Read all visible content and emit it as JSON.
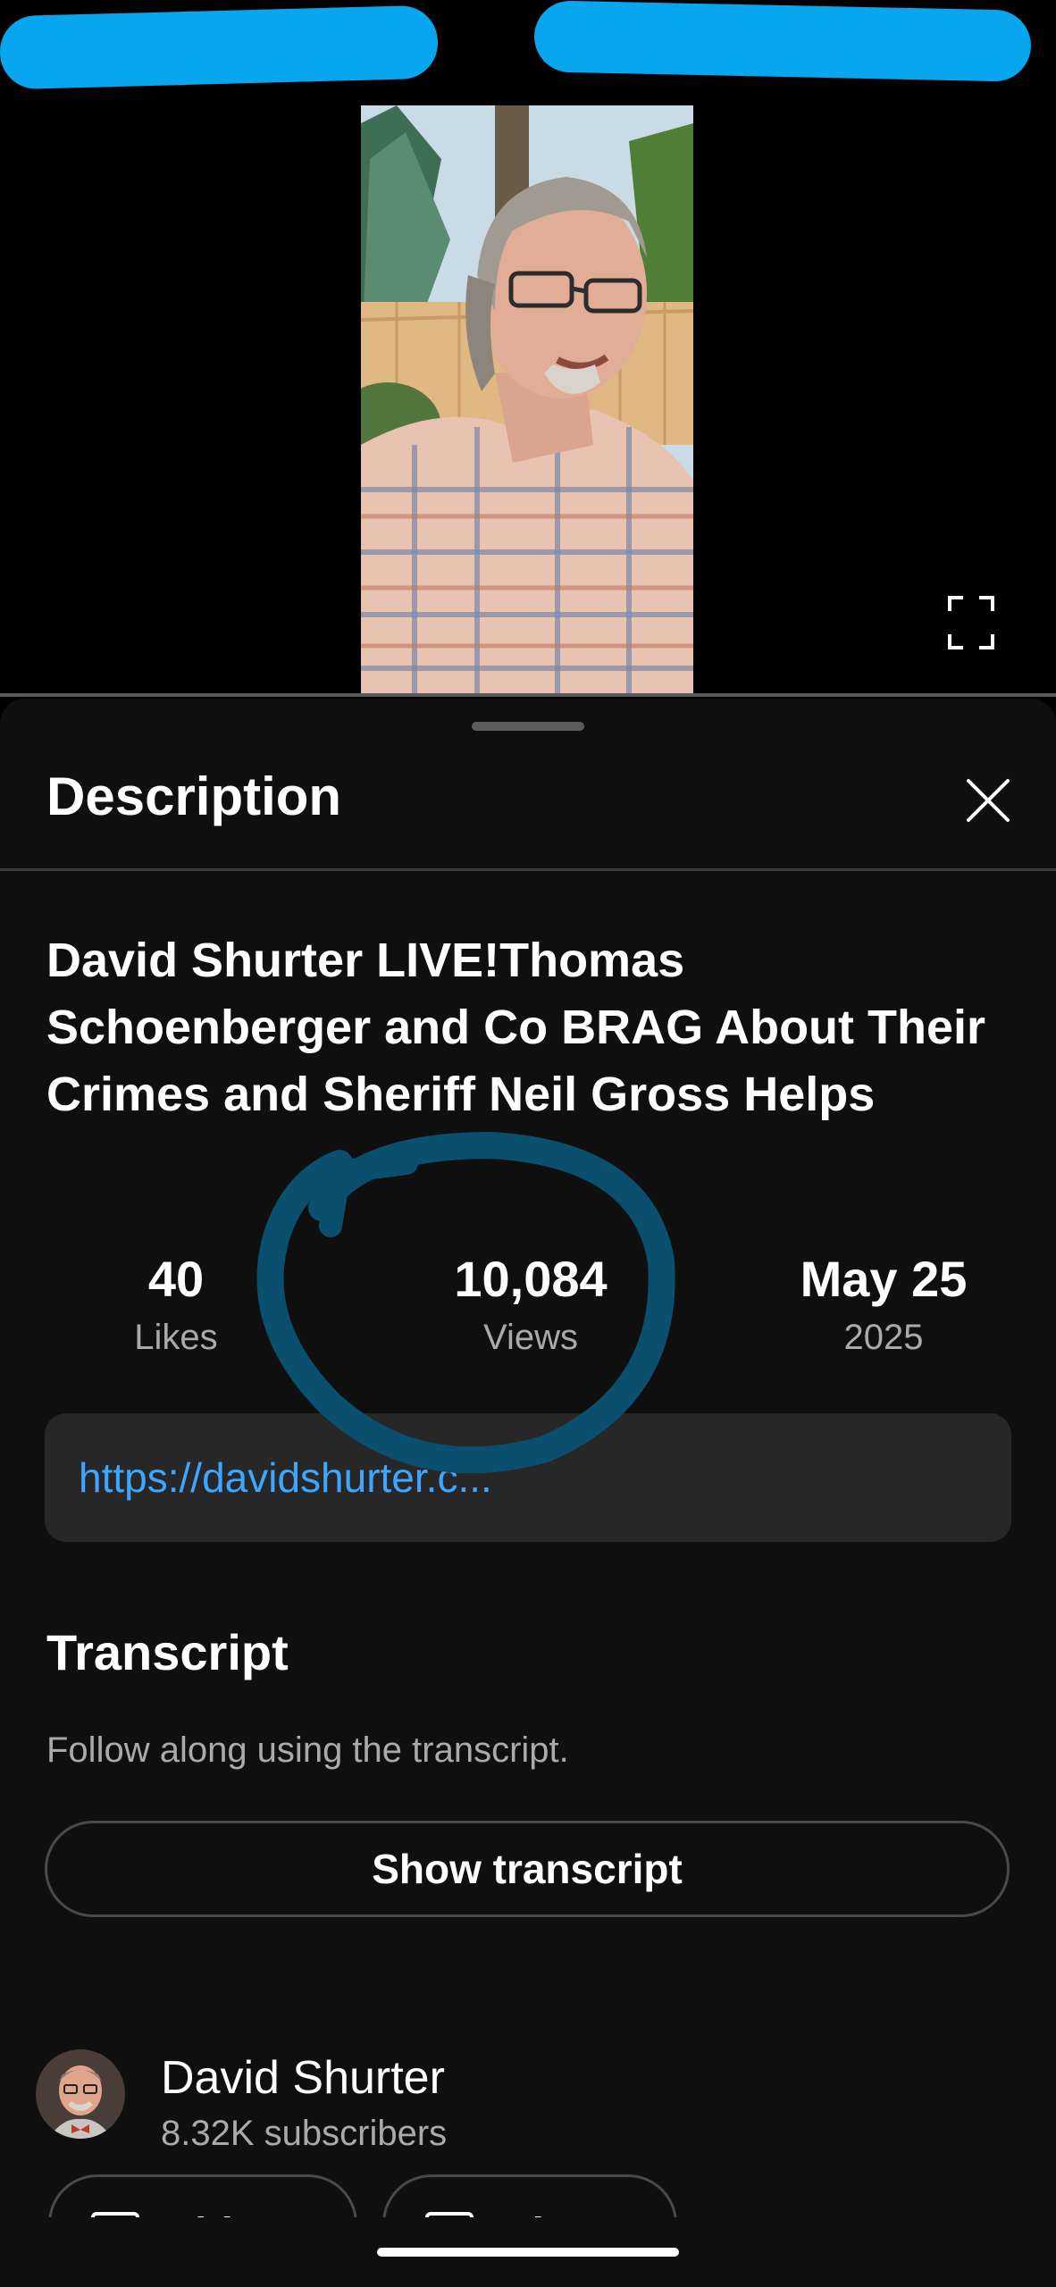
{
  "description_sheet": {
    "title": "Description",
    "video_title": "David Shurter LIVE!Thomas Schoenberger and Co BRAG About Their Crimes and Sheriff Neil Gross Helps",
    "stats": {
      "likes_value": "40",
      "likes_label": "Likes",
      "views_value": "10,084",
      "views_label": "Views",
      "date_value": "May 25",
      "date_year": "2025"
    },
    "link": "https://davidshurter.c...",
    "transcript": {
      "title": "Transcript",
      "subtitle": "Follow along using the transcript.",
      "button_label": "Show transcript"
    },
    "channel": {
      "name": "David Shurter",
      "subscribers": "8.32K subscribers"
    },
    "chips": {
      "videos_label": "Videos",
      "about_label": "About"
    }
  },
  "icons": {
    "fullscreen": "fullscreen-icon",
    "close": "close-icon",
    "videos": "video-icon",
    "about": "person-icon"
  },
  "colors": {
    "sheet_background": "#0f0f0f",
    "link": "#3ea6ff",
    "secondary_text": "#aaaaaa",
    "link_box": "#272727",
    "redaction_scribble": "#08a6ee",
    "annotation_circle": "#0b4f6f"
  }
}
